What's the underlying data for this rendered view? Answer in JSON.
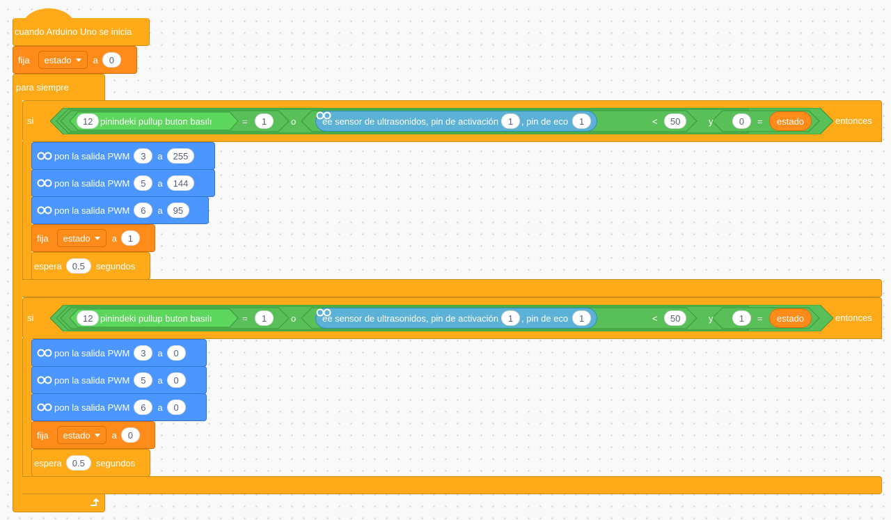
{
  "hat": {
    "label": "cuando Arduino Uno se inicia"
  },
  "set_initial": {
    "label": "fija",
    "variable": "estado",
    "to": "a",
    "value": "0"
  },
  "forever": {
    "label": "para siempre"
  },
  "if_blocks": [
    {
      "si": "si",
      "condition": {
        "pin": "12",
        "pullup_text": "pinindeki pullup buton basılı",
        "eq1": "=",
        "eq1_value": "1",
        "or": "o",
        "sensor_text": "ee sensor de ultrasonidos, pin de activación",
        "trig_pin": "1",
        "echo_label": ", pin de eco",
        "echo_pin": "1",
        "lt": "<",
        "lt_value": "50",
        "and": "y",
        "eq2_value": "0",
        "eq2": "=",
        "var": "estado"
      },
      "then": "entonces",
      "pwm": [
        {
          "label": "pon la salida PWM",
          "pin": "3",
          "to": "a",
          "value": "255"
        },
        {
          "label": "pon la salida PWM",
          "pin": "5",
          "to": "a",
          "value": "144"
        },
        {
          "label": "pon la salida PWM",
          "pin": "6",
          "to": "a",
          "value": "95"
        }
      ],
      "set": {
        "label": "fija",
        "variable": "estado",
        "to": "a",
        "value": "1"
      },
      "wait": {
        "label": "espera",
        "value": "0.5",
        "unit": "segundos"
      }
    },
    {
      "si": "si",
      "condition": {
        "pin": "12",
        "pullup_text": "pinindeki pullup buton basılı",
        "eq1": "=",
        "eq1_value": "1",
        "or": "o",
        "sensor_text": "ee sensor de ultrasonidos, pin de activación",
        "trig_pin": "1",
        "echo_label": ", pin de eco",
        "echo_pin": "1",
        "lt": "<",
        "lt_value": "50",
        "and": "y",
        "eq2_value": "1",
        "eq2": "=",
        "var": "estado"
      },
      "then": "entonces",
      "pwm": [
        {
          "label": "pon la salida PWM",
          "pin": "3",
          "to": "a",
          "value": "0"
        },
        {
          "label": "pon la salida PWM",
          "pin": "5",
          "to": "a",
          "value": "0"
        },
        {
          "label": "pon la salida PWM",
          "pin": "6",
          "to": "a",
          "value": "0"
        }
      ],
      "set": {
        "label": "fija",
        "variable": "estado",
        "to": "a",
        "value": "0"
      },
      "wait": {
        "label": "espera",
        "value": "0.5",
        "unit": "segundos"
      }
    }
  ],
  "colors": {
    "control": "#ffab19",
    "variables": "#ff8c1a",
    "arduino": "#4c97ff",
    "operators": "#59c059",
    "sensing": "#5cb1d6"
  },
  "icons": [
    "arduino-infinity-icon",
    "dropdown-caret-icon",
    "loop-arrow-icon"
  ]
}
